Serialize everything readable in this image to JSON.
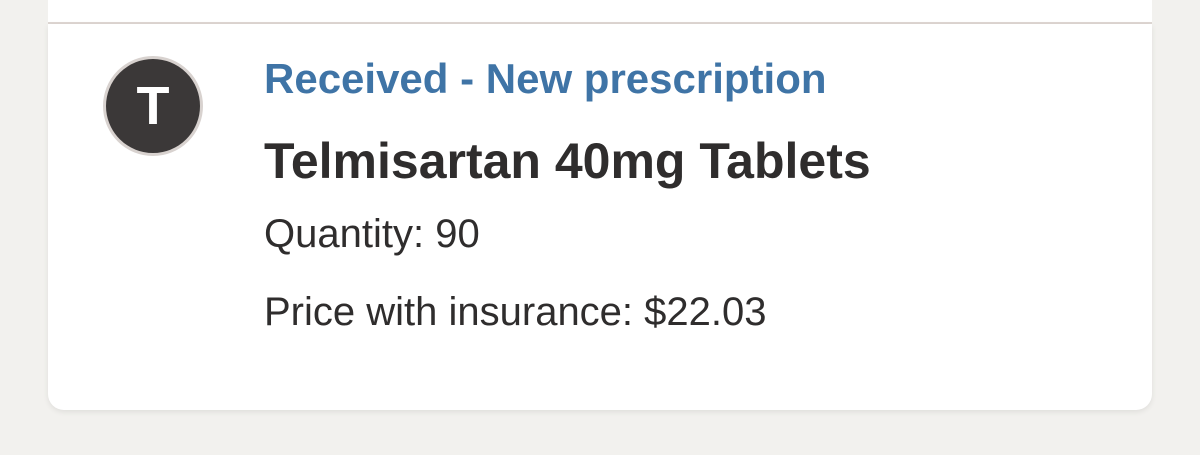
{
  "prescription": {
    "avatar_initial": "T",
    "status": "Received - New prescription",
    "drug_name": "Telmisartan 40mg Tablets",
    "quantity": "Quantity: 90",
    "price": "Price with insurance: $22.03"
  },
  "colors": {
    "status_text": "#3f74a6",
    "avatar_bg": "#3b3838",
    "text_primary": "#2f2d2d",
    "page_bg": "#f2f1ee"
  }
}
